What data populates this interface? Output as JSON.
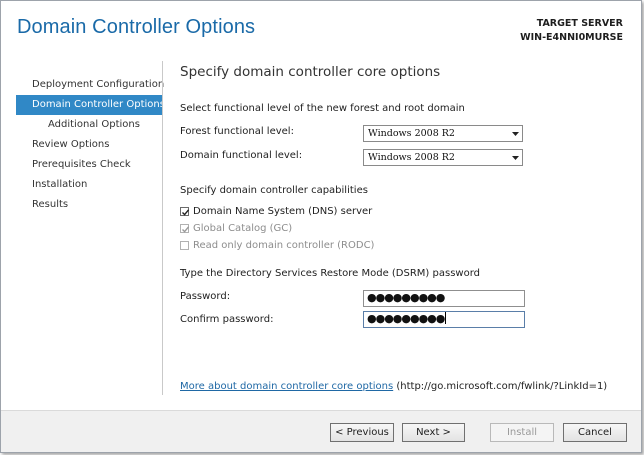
{
  "window": {
    "title": "Domain Controller Options",
    "target_server_label": "TARGET SERVER",
    "target_server_name": "WIN-E4NNI0MURSE"
  },
  "nav": {
    "items": [
      {
        "label": "Deployment Configuration"
      },
      {
        "label": "Domain Controller Options"
      },
      {
        "label": "Additional Options"
      },
      {
        "label": "Review Options"
      },
      {
        "label": "Prerequisites Check"
      },
      {
        "label": "Installation"
      },
      {
        "label": "Results"
      }
    ]
  },
  "main": {
    "heading": "Specify domain controller core options",
    "functional_level_section": "Select functional level of the new forest and root domain",
    "forest_label": "Forest functional level:",
    "forest_value": "Windows 2008 R2",
    "domain_label": "Domain functional level:",
    "domain_value": "Windows 2008 R2",
    "capabilities_section": "Specify domain controller capabilities",
    "capabilities": [
      {
        "label": "Domain Name System (DNS) server",
        "checked": true,
        "enabled": true
      },
      {
        "label": "Global Catalog (GC)",
        "checked": true,
        "enabled": false
      },
      {
        "label": "Read only domain controller (RODC)",
        "checked": false,
        "enabled": false
      }
    ],
    "dsrm_section": "Type the Directory Services Restore Mode (DSRM) password",
    "password_label": "Password:",
    "password_value": "●●●●●●●●●",
    "confirm_label": "Confirm password:",
    "confirm_value": "●●●●●●●●●",
    "more_link": "More about domain controller core options",
    "more_url": "(http://go.microsoft.com/fwlink/?LinkId=1)"
  },
  "footer": {
    "previous": "< Previous",
    "next": "Next >",
    "install": "Install",
    "cancel": "Cancel"
  },
  "colors": {
    "title": "#1a6aa8",
    "nav_active": "#3088c6",
    "link": "#1f68a5"
  }
}
